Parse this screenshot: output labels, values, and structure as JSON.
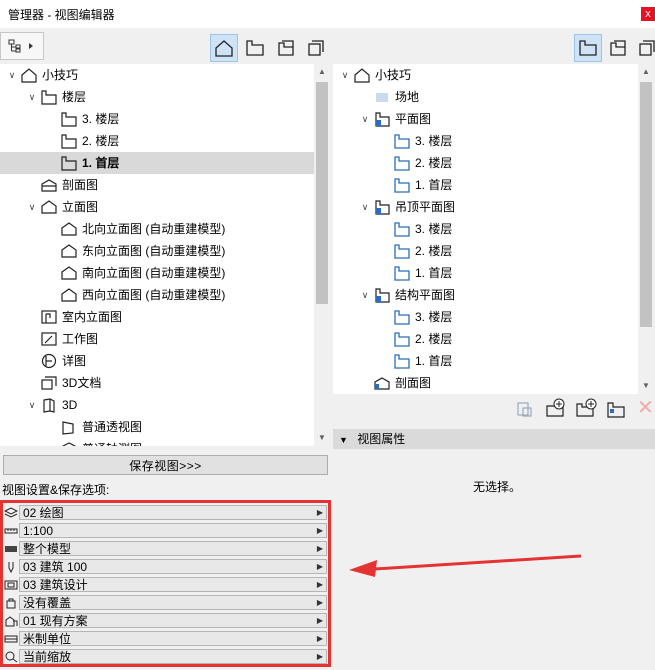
{
  "window": {
    "title": "管理器 - 视图编辑器",
    "close_glyph": "x"
  },
  "left_tree": {
    "rows": [
      {
        "label": "小技巧",
        "indent": 0,
        "toggle": "v",
        "icon": "house-icon"
      },
      {
        "label": "楼层",
        "indent": 1,
        "toggle": "v",
        "icon": "story-icon"
      },
      {
        "label": "3. 楼层",
        "indent": 2,
        "toggle": "",
        "icon": "story-icon"
      },
      {
        "label": "2. 楼层",
        "indent": 2,
        "toggle": "",
        "icon": "story-icon"
      },
      {
        "label": "1. 首层",
        "indent": 2,
        "toggle": "",
        "icon": "story-icon",
        "selected": true
      },
      {
        "label": "剖面图",
        "indent": 1,
        "toggle": "",
        "icon": "section-icon"
      },
      {
        "label": "立面图",
        "indent": 1,
        "toggle": "v",
        "icon": "elevation-icon"
      },
      {
        "label": "北向立面图 (自动重建模型)",
        "indent": 2,
        "toggle": "",
        "icon": "elevation-icon"
      },
      {
        "label": "东向立面图 (自动重建模型)",
        "indent": 2,
        "toggle": "",
        "icon": "elevation-icon"
      },
      {
        "label": "南向立面图 (自动重建模型)",
        "indent": 2,
        "toggle": "",
        "icon": "elevation-icon"
      },
      {
        "label": "西向立面图 (自动重建模型)",
        "indent": 2,
        "toggle": "",
        "icon": "elevation-icon"
      },
      {
        "label": "室内立面图",
        "indent": 1,
        "toggle": "",
        "icon": "interior-elevation-icon"
      },
      {
        "label": "工作图",
        "indent": 1,
        "toggle": "",
        "icon": "worksheet-icon"
      },
      {
        "label": "详图",
        "indent": 1,
        "toggle": "",
        "icon": "detail-icon"
      },
      {
        "label": "3D文档",
        "indent": 1,
        "toggle": "",
        "icon": "3d-document-icon"
      },
      {
        "label": "3D",
        "indent": 1,
        "toggle": "v",
        "icon": "3d-icon"
      },
      {
        "label": "普通透视图",
        "indent": 2,
        "toggle": "",
        "icon": "perspective-icon"
      },
      {
        "label": "普通轴测图",
        "indent": 2,
        "toggle": "",
        "icon": "axonometry-icon"
      }
    ]
  },
  "right_tree": {
    "rows": [
      {
        "label": "小技巧",
        "indent": 0,
        "toggle": "v",
        "icon": "house-icon"
      },
      {
        "label": "场地",
        "indent": 1,
        "toggle": "",
        "icon": "site-icon"
      },
      {
        "label": "平面图",
        "indent": 1,
        "toggle": "v",
        "icon": "plan-folder-icon"
      },
      {
        "label": "3. 楼层",
        "indent": 2,
        "toggle": "",
        "icon": "story-blue-icon"
      },
      {
        "label": "2. 楼层",
        "indent": 2,
        "toggle": "",
        "icon": "story-blue-icon"
      },
      {
        "label": "1. 首层",
        "indent": 2,
        "toggle": "",
        "icon": "story-blue-icon"
      },
      {
        "label": "吊顶平面图",
        "indent": 1,
        "toggle": "v",
        "icon": "plan-folder-icon"
      },
      {
        "label": "3. 楼层",
        "indent": 2,
        "toggle": "",
        "icon": "story-blue-icon"
      },
      {
        "label": "2. 楼层",
        "indent": 2,
        "toggle": "",
        "icon": "story-blue-icon"
      },
      {
        "label": "1. 首层",
        "indent": 2,
        "toggle": "",
        "icon": "story-blue-icon"
      },
      {
        "label": "结构平面图",
        "indent": 1,
        "toggle": "v",
        "icon": "plan-folder-icon"
      },
      {
        "label": "3. 楼层",
        "indent": 2,
        "toggle": "",
        "icon": "story-blue-icon"
      },
      {
        "label": "2. 楼层",
        "indent": 2,
        "toggle": "",
        "icon": "story-blue-icon"
      },
      {
        "label": "1. 首层",
        "indent": 2,
        "toggle": "",
        "icon": "story-blue-icon"
      },
      {
        "label": "剖面图",
        "indent": 1,
        "toggle": "",
        "icon": "section-blue-icon"
      }
    ]
  },
  "save_view_label": "保存视图>>>",
  "settings_label": "视图设置&保存选项:",
  "settings": [
    {
      "icon": "layers-icon",
      "value": "02 绘图"
    },
    {
      "icon": "scale-icon",
      "value": "1:100"
    },
    {
      "icon": "structure-display-icon",
      "value": "整个模型"
    },
    {
      "icon": "pen-set-icon",
      "value": "03 建筑 100"
    },
    {
      "icon": "model-view-icon",
      "value": "03 建筑设计"
    },
    {
      "icon": "override-icon",
      "value": "没有覆盖"
    },
    {
      "icon": "renovation-icon",
      "value": "01 现有方案"
    },
    {
      "icon": "dimension-icon",
      "value": "米制单位"
    },
    {
      "icon": "zoom-icon",
      "value": "当前缩放"
    }
  ],
  "properties": {
    "header": "视图属性",
    "no_selection": "无选择。"
  },
  "colors": {
    "accent_blue": "#2a6ebb",
    "highlight_red": "#e53333",
    "selected_row": "#d9d9d9"
  }
}
